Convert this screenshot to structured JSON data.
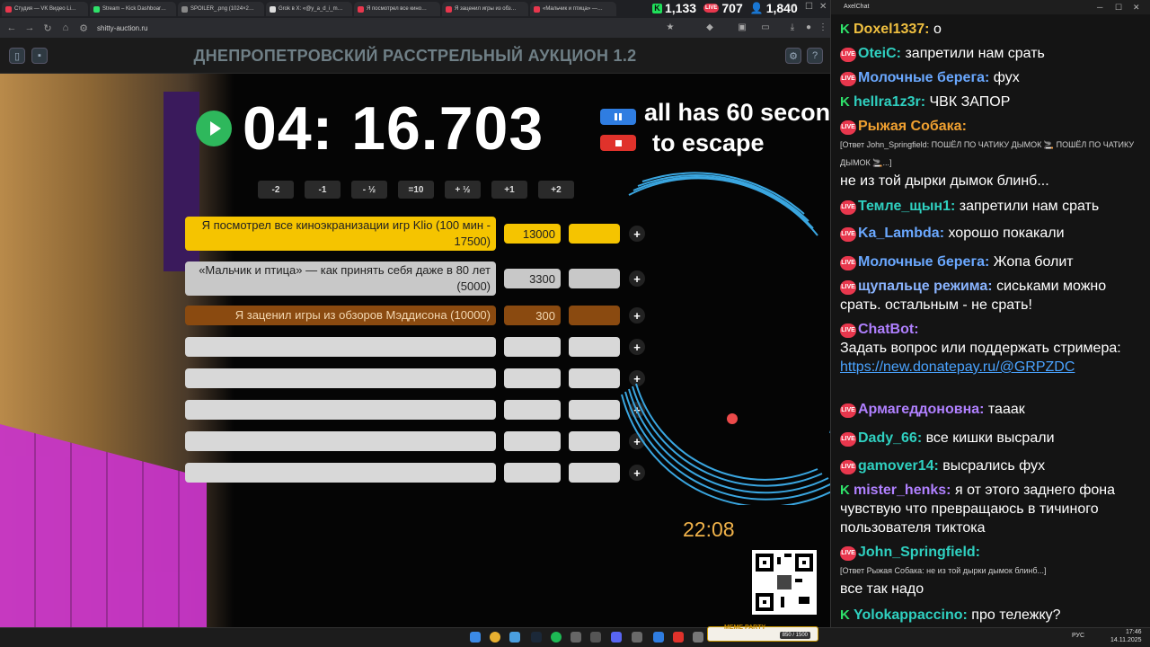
{
  "browser": {
    "tabs": [
      {
        "label": "Студия — VK Видео Li…",
        "color": "#e8374d"
      },
      {
        "label": "Stream – Kick Dashboar…",
        "color": "#2fe26a"
      },
      {
        "label": "SPOILER_.png (1024×2…",
        "color": "#888888"
      },
      {
        "label": "Grok в X: «@y_a_d_i_m…",
        "color": "#dddddd"
      },
      {
        "label": "Я посмотрел все кино…",
        "color": "#e8374d"
      },
      {
        "label": "Я заценил игры из обз…",
        "color": "#e8374d"
      },
      {
        "label": "«Мальчик и птица» —…",
        "color": "#e8374d"
      }
    ],
    "url": "shitty-auction.ru",
    "counters": {
      "kick": "1,133",
      "vk": "707",
      "viewers": "1,840"
    }
  },
  "auction": {
    "title": "ДНЕПРОПЕТРОВСКИЙ РАССТРЕЛЬНЫЙ АУКЦИОН 1.2",
    "timer": "04: 16.703",
    "overlay_line1": "all has 60 secon",
    "overlay_line2": "to escape",
    "adjust_buttons": [
      "-2",
      "-1",
      "- ½",
      "=10",
      "+ ½",
      "+1",
      "+2"
    ],
    "lots": [
      {
        "name": "Я посмотрел все киноэкранизации игр Klio (100 мин - 17500)",
        "amount": "13000",
        "color": "#f5c400",
        "extra": "#f5c400"
      },
      {
        "name": "«Мальчик и птица» — как принять себя даже в 80 лет (5000)",
        "amount": "3300",
        "color": "#c8c8c8",
        "extra": "#c8c8c8"
      },
      {
        "name": "Я заценил игры из обзоров Мэддисона (10000)",
        "amount": "300",
        "color": "#8a4a10",
        "extra": "#8a4a10"
      },
      {
        "name": "",
        "amount": "",
        "color": "#d8d8d8",
        "extra": "#d8d8d8"
      },
      {
        "name": "",
        "amount": "",
        "color": "#d8d8d8",
        "extra": "#d8d8d8"
      },
      {
        "name": "",
        "amount": "",
        "color": "#d8d8d8",
        "extra": "#d8d8d8"
      },
      {
        "name": "",
        "amount": "",
        "color": "#d8d8d8",
        "extra": "#d8d8d8"
      },
      {
        "name": "",
        "amount": "",
        "color": "#d8d8d8",
        "extra": "#d8d8d8"
      }
    ],
    "plus_label": "+",
    "clock": "22:08"
  },
  "chat": {
    "title": "AxelChat",
    "messages": [
      {
        "platform": "kick",
        "nick": "Doxel1337:",
        "nick_color": "#f0c040",
        "text": "о"
      },
      {
        "platform": "live",
        "nick": "OteiC:",
        "nick_color": "#2fd0c0",
        "text": "запретили нам срать"
      },
      {
        "platform": "live",
        "nick": "Молочные берега:",
        "nick_color": "#6aa8ff",
        "text": "фух"
      },
      {
        "platform": "kick",
        "nick": "hellra1z3r:",
        "nick_color": "#2fd0c0",
        "text": "ЧВК ЗАПОР"
      },
      {
        "platform": "live",
        "nick": "Рыжая Собака:",
        "nick_color": "#f0a030",
        "reply": "[Ответ John_Springfield: ПОШЁЛ ПО ЧАТИКУ ДЫМОК 🚬 ПОШЁЛ ПО ЧАТИКУ ДЫМОК 🚬...]",
        "text": "не из той дырки дымок блинб..."
      },
      {
        "platform": "live",
        "nick": "Темле_щын1:",
        "nick_color": "#2fd0c0",
        "text": "запретили нам срать"
      },
      {
        "platform": "live",
        "nick": "Ka_Lambda:",
        "nick_color": "#6aa8ff",
        "text": "хорошо покакали"
      },
      {
        "platform": "live",
        "nick": "Молочные берега:",
        "nick_color": "#6aa8ff",
        "text": "Жопа болит"
      },
      {
        "platform": "live",
        "nick": "щупальце режима:",
        "nick_color": "#8ab4ff",
        "text": "сиськами можно срать. остальным - не срать!"
      },
      {
        "platform": "live",
        "nick": "ChatBot:",
        "nick_color": "#b080ff",
        "text": "Задать вопрос или поддержать стримера:",
        "link": "https://new.donatepay.ru/@GRPZDC"
      },
      {
        "platform": "live",
        "nick": "Армагеддоновна:",
        "nick_color": "#b080ff",
        "text": "тааак"
      },
      {
        "platform": "live",
        "nick": "Dady_66:",
        "nick_color": "#2fd0c0",
        "text": "все кишки высрали"
      },
      {
        "platform": "live",
        "nick": "gamover14:",
        "nick_color": "#2fd0c0",
        "text": "высрались фух"
      },
      {
        "platform": "kick",
        "nick": "mister_henks:",
        "nick_color": "#b080ff",
        "text": "я от этого заднего фона чувствую что превращаюсь в тичиного пользователя тиктока"
      },
      {
        "platform": "live",
        "nick": "John_Springfield:",
        "nick_color": "#2fd0c0",
        "reply": "[Ответ Рыжая Собака: не из той дырки дымок блинб...]",
        "text": "все так надо"
      },
      {
        "platform": "kick",
        "nick": "Yolokappaccino:",
        "nick_color": "#2fd0c0",
        "text": "про тележку?"
      }
    ]
  },
  "taskbar": {
    "meme_title": "MEME PARTY",
    "meme_count": "850 / 1500",
    "lang": "РУС",
    "time": "17:46",
    "date": "14.11.2025"
  }
}
